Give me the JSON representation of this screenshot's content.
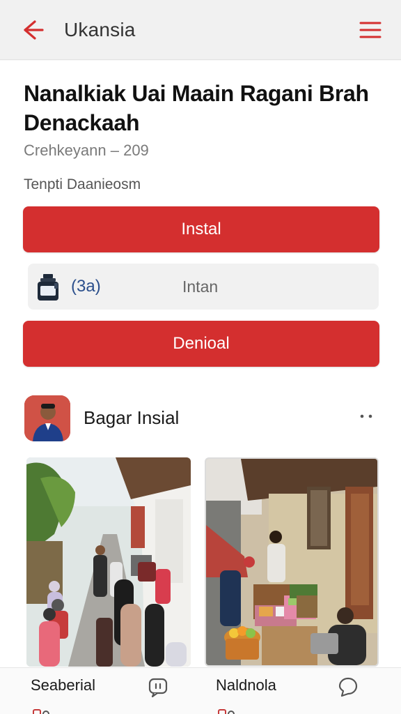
{
  "appbar": {
    "title": "Ukansia",
    "back_icon": "arrow-left-icon",
    "menu_icon": "hamburger-menu-icon",
    "accent": "#d42f2f"
  },
  "app": {
    "headline": "Nanalkiak Uai Maain Ragani Brah Denackaah",
    "subtitle": "Crehkeyann – 209",
    "caption": "Tenpti Daanieosm"
  },
  "actions": {
    "install_label": "Instal",
    "download_label": "Denioal"
  },
  "info": {
    "count": "(3a)",
    "label": "Intan",
    "icon": "jar-icon"
  },
  "post": {
    "author": "Bagar Insial",
    "more_icon": "more-dots-icon"
  },
  "bottom": {
    "left_label": "Seaberial",
    "right_label": "Naldnola",
    "left_icon": "chat-bubble-icon",
    "right_icon": "comment-icon"
  }
}
